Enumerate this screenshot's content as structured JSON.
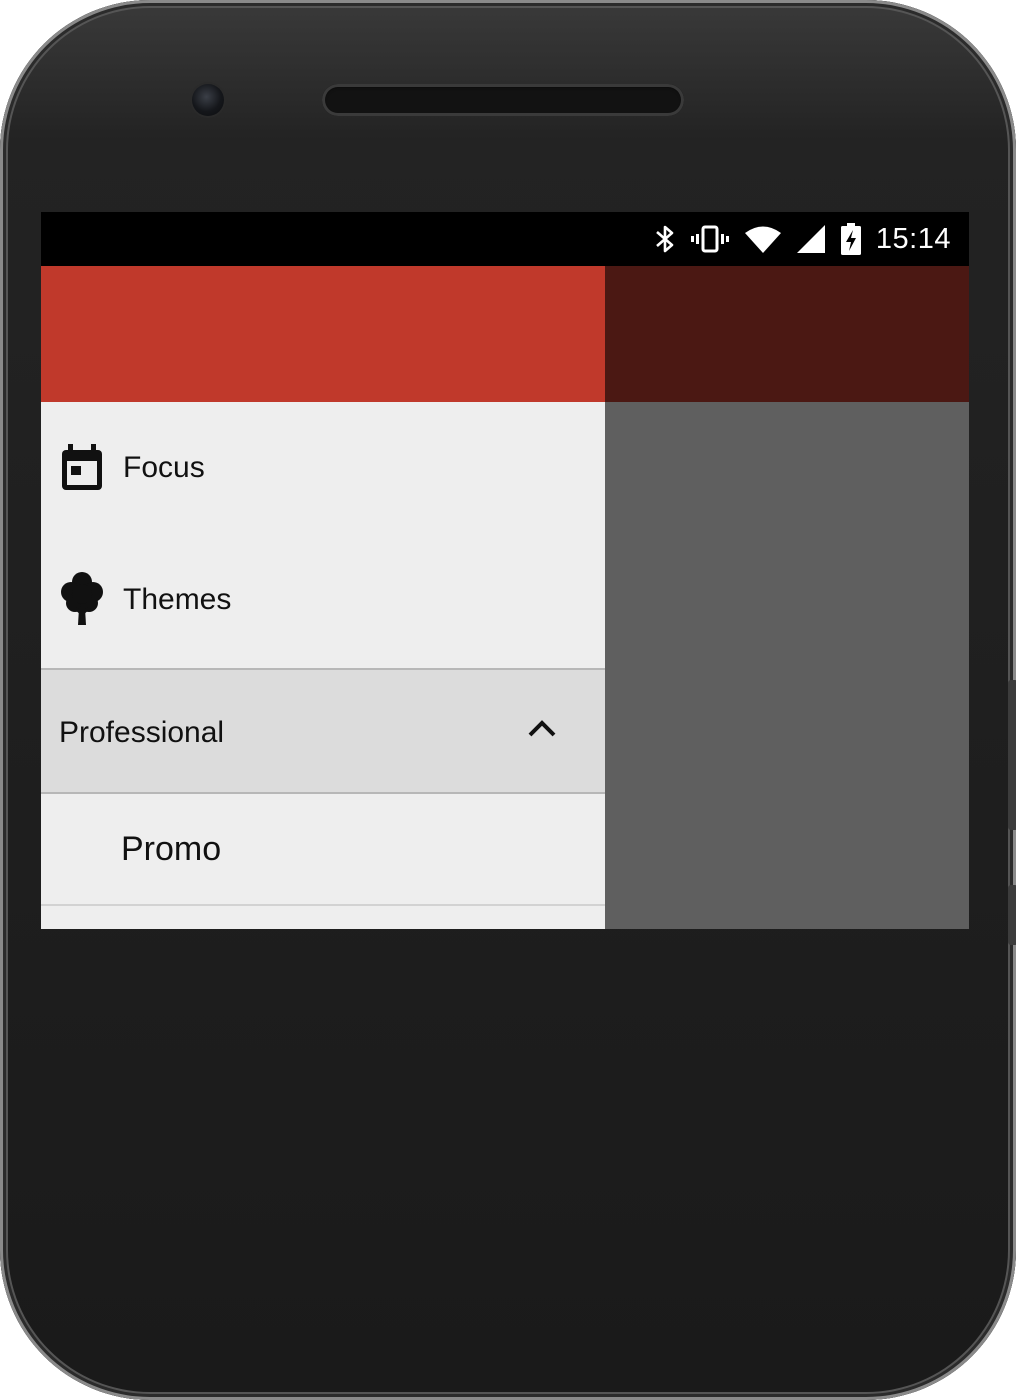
{
  "status_bar": {
    "time": "15:14",
    "icons": [
      "bluetooth-icon",
      "vibrate-icon",
      "wifi-icon",
      "cell-signal-icon",
      "battery-charging-icon"
    ]
  },
  "drawer": {
    "header_color": "#c0392b",
    "items": [
      {
        "label": "Focus",
        "icon": "calendar-today-icon"
      },
      {
        "label": "Themes",
        "icon": "tree-icon"
      }
    ],
    "section": {
      "label": "Professional",
      "expanded": true,
      "icon": "chevron-up-icon"
    },
    "sub_items": [
      {
        "label": "Promo"
      }
    ]
  },
  "colors": {
    "accent": "#c0392b",
    "scrim_toolbar": "#4b1813",
    "scrim_body": "#5f5f5f",
    "drawer_bg": "#eeeeee",
    "section_bg": "#dcdcdc"
  }
}
